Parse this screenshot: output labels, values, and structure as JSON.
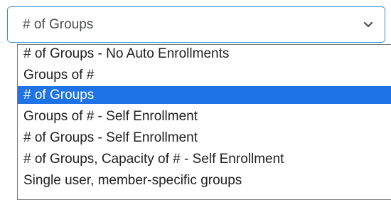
{
  "select": {
    "value": "# of Groups",
    "chevron_icon": "chevron-down-icon"
  },
  "options": [
    {
      "label": "# of Groups - No Auto Enrollments",
      "selected": false
    },
    {
      "label": "Groups of #",
      "selected": false
    },
    {
      "label": "# of Groups",
      "selected": true
    },
    {
      "label": "Groups of # - Self Enrollment",
      "selected": false
    },
    {
      "label": "# of Groups - Self Enrollment",
      "selected": false
    },
    {
      "label": "# of Groups, Capacity of # - Self Enrollment",
      "selected": false
    },
    {
      "label": "Single user, member-specific groups",
      "selected": false
    }
  ],
  "colors": {
    "focus_border": "#2f8fd8",
    "selected_background": "#1e74e6",
    "selected_text": "#ffffff"
  }
}
